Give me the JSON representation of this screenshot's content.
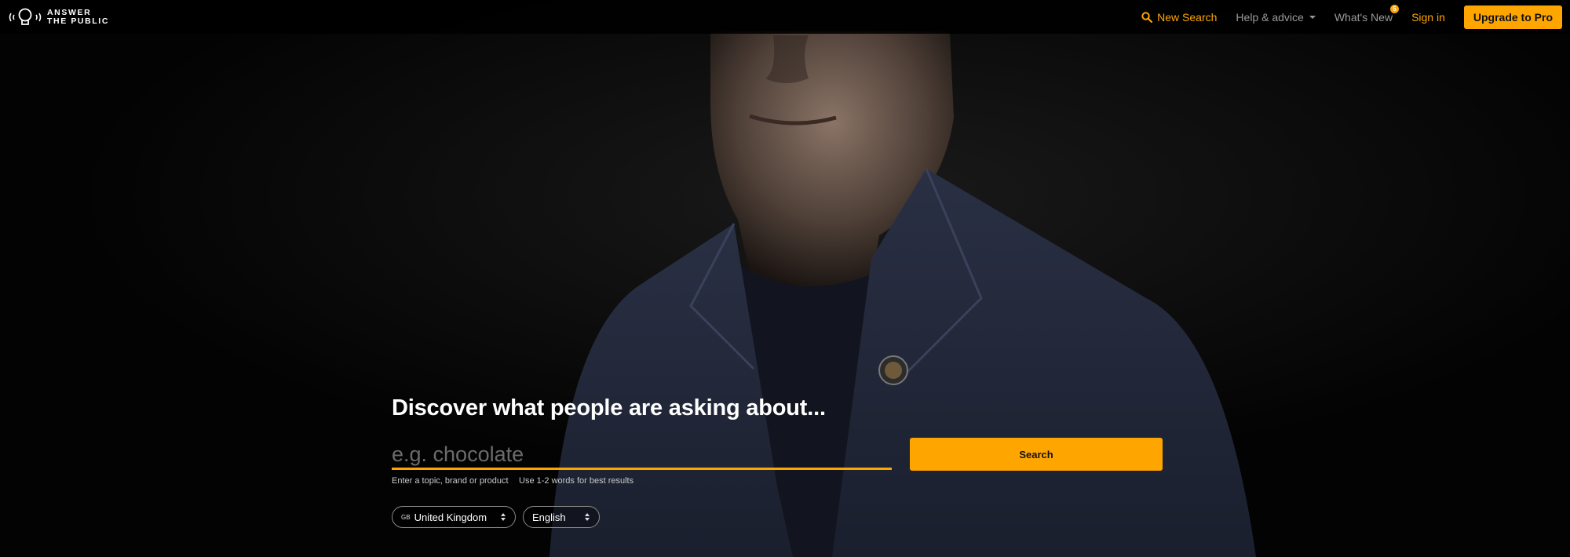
{
  "brand": {
    "line1": "ANSWER",
    "line2": "THE PUBLIC",
    "logo_icon": "lightbulb-soundwave-icon"
  },
  "nav": {
    "new_search": "New Search",
    "help": "Help & advice",
    "whats_new": "What's New",
    "whats_new_badge": "5",
    "sign_in": "Sign in",
    "upgrade": "Upgrade to Pro"
  },
  "hero": {
    "headline": "Discover what people are asking about...",
    "search_placeholder": "e.g. chocolate",
    "search_button": "Search",
    "hint_topic": "Enter a topic, brand or product",
    "hint_words": "Use 1-2 words for best results",
    "country_flag": "GB",
    "country": "United Kingdom",
    "language": "English"
  },
  "colors": {
    "accent": "#ffa500",
    "background": "#030303"
  }
}
